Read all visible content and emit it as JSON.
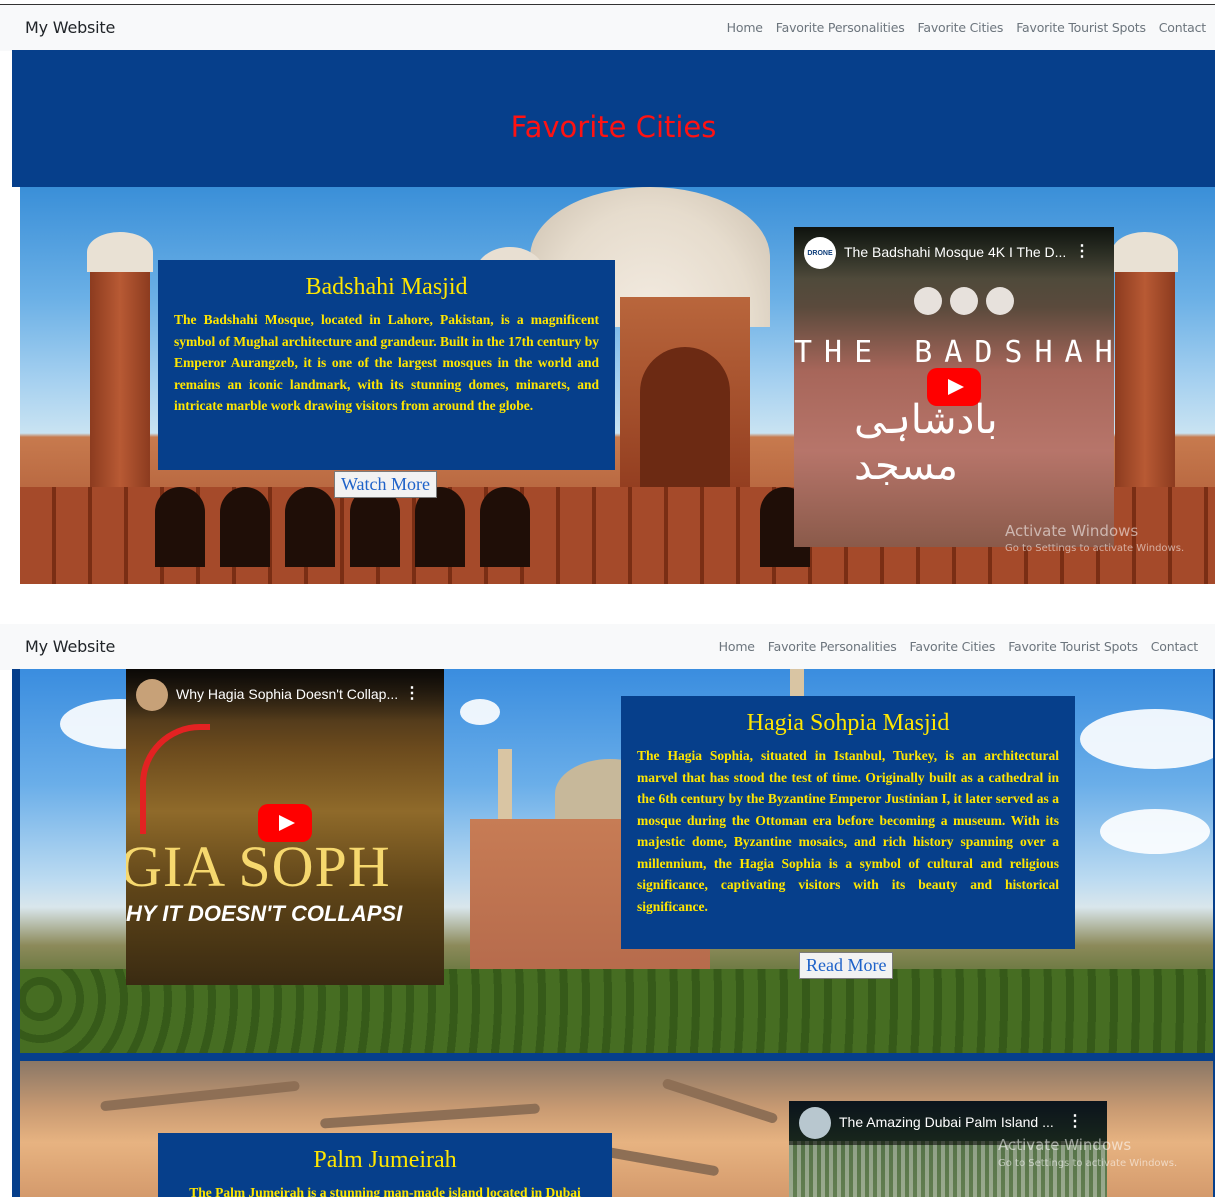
{
  "screen1": {
    "navbar": {
      "brand": "My Website",
      "links": [
        "Home",
        "Favorite Personalities",
        "Favorite Cities",
        "Favorite Tourist Spots",
        "Contact"
      ]
    },
    "page_heading": "Favorite Cities",
    "card": {
      "title": "Badshahi Masjid",
      "text": "The Badshahi Mosque, located in Lahore, Pakistan, is a magnificent symbol of Mughal architecture and grandeur. Built in the 17th century by Emperor Aurangzeb, it is one of the largest mosques in the world and remains an iconic landmark, with its stunning domes, minarets, and intricate marble work drawing visitors from around the globe.",
      "button": "Watch More"
    },
    "video": {
      "title": "The Badshahi Mosque 4K I The D...",
      "channel_badge": "DRONE",
      "overlay_text": "THE BADSHAHI MOSQ",
      "overlay_urdu": "بادشاہی مسجد"
    },
    "watermark": {
      "title": "Activate Windows",
      "subtitle": "Go to Settings to activate Windows."
    }
  },
  "screen2": {
    "navbar": {
      "brand": "My Website",
      "links": [
        "Home",
        "Favorite Personalities",
        "Favorite Cities",
        "Favorite Tourist Spots",
        "Contact"
      ]
    },
    "hagia": {
      "video": {
        "title": "Why Hagia Sophia Doesn't Collap...",
        "overlay_text": "GIA SOPH",
        "overlay_sub": "HY IT DOESN'T COLLAPSI"
      },
      "card": {
        "title": "Hagia Sohpia Masjid",
        "text": "The Hagia Sophia, situated in Istanbul, Turkey, is an architectural marvel that has stood the test of time. Originally built as a cathedral in the 6th century by the Byzantine Emperor Justinian I, it later served as a mosque during the Ottoman era before becoming a museum. With its majestic dome, Byzantine mosaics, and rich history spanning over a millennium, the Hagia Sophia is a symbol of cultural and religious significance, captivating visitors with its beauty and historical significance.",
        "button": "Read More"
      }
    },
    "palm": {
      "card": {
        "title": "Palm Jumeirah",
        "text": "The Palm Jumeirah is a stunning man-made island located in Dubai"
      },
      "video": {
        "title": "The Amazing Dubai Palm Island ..."
      }
    },
    "watermark": {
      "title": "Activate Windows",
      "subtitle": "Go to Settings to activate Windows."
    }
  },
  "colors": {
    "navy": "#063f8b",
    "heading_red": "#ff1212",
    "card_text": "#ffe600",
    "button_text": "#1e62c9",
    "youtube_red": "#ff0000"
  }
}
